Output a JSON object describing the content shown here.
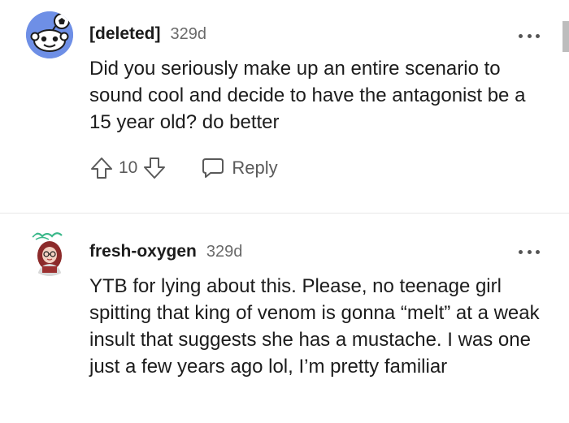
{
  "comments": [
    {
      "username": "[deleted]",
      "age": "329d",
      "body": "Did you seriously make up an entire scenario to sound cool and decide to have the antagonist be a 15 year old? do better",
      "votes": "10",
      "reply_label": "Reply",
      "avatar_icon": "snoo-avatar-icon",
      "avatar_color": "#6e8fe6"
    },
    {
      "username": "fresh-oxygen",
      "age": "329d",
      "body": "YTB for lying about this. Please, no teenage girl spitting that king of venom is gonna “melt” at a weak insult that suggests she has a mustache. I was one just a few years ago lol, I’m pretty familiar",
      "avatar_icon": "custom-avatar-icon"
    }
  ],
  "icons": {
    "upvote": "arrow-up-icon",
    "downvote": "arrow-down-icon",
    "reply": "speech-bubble-icon",
    "more": "more-options-icon"
  }
}
